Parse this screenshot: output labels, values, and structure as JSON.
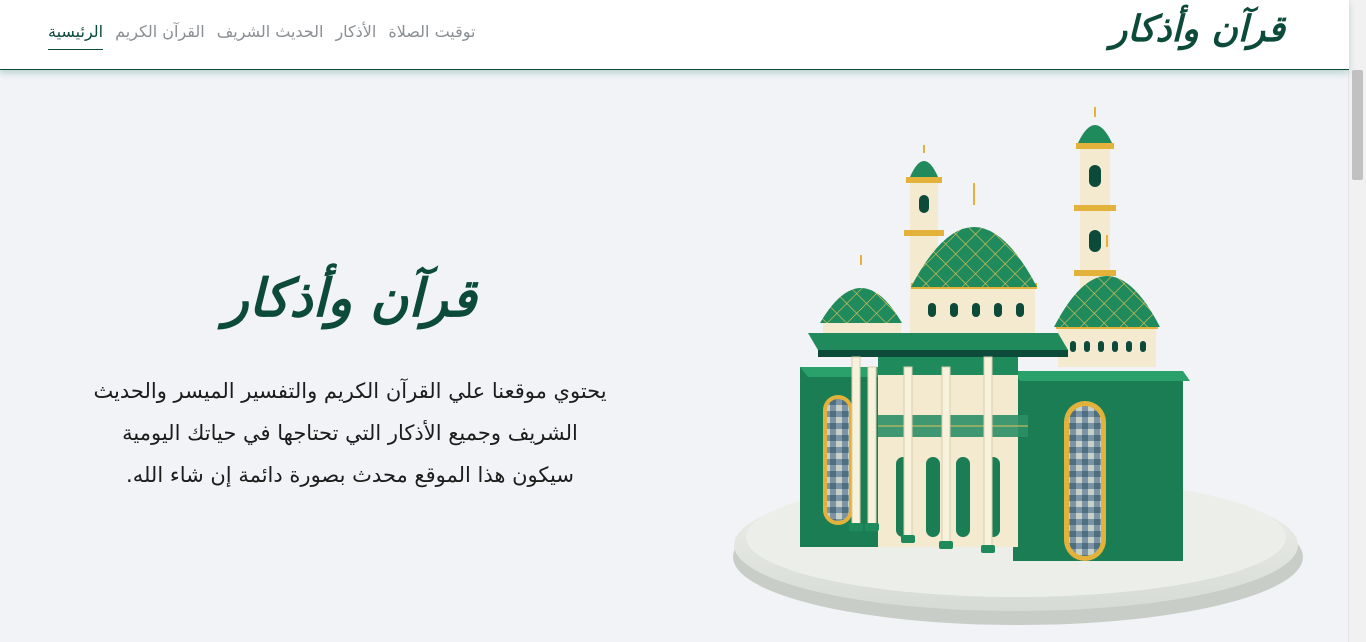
{
  "brand": {
    "title": "قرآن وأذكار"
  },
  "nav": {
    "items": [
      {
        "label": "الرئيسية",
        "active": true
      },
      {
        "label": "القرآن الكريم",
        "active": false
      },
      {
        "label": "الحديث الشريف",
        "active": false
      },
      {
        "label": "الأذكار",
        "active": false
      },
      {
        "label": "توقيت الصلاة",
        "active": false
      }
    ]
  },
  "hero": {
    "title": "قرآن وأذكار",
    "lines": [
      "يحتوي موقعنا علي القرآن الكريم والتفسير الميسر والحديث",
      "الشريف وجميع الأذكار التي تحتاجها في حياتك اليومية",
      "سيكون هذا الموقع محدث بصورة دائمة إن شاء الله."
    ]
  },
  "colors": {
    "primary": "#0c4a3a",
    "dome": "#1f8a5c",
    "gold": "#e2b23a",
    "cream": "#f3ead0",
    "background": "#f1f3f6"
  },
  "icons": {
    "hero_image": "mosque-illustration"
  }
}
